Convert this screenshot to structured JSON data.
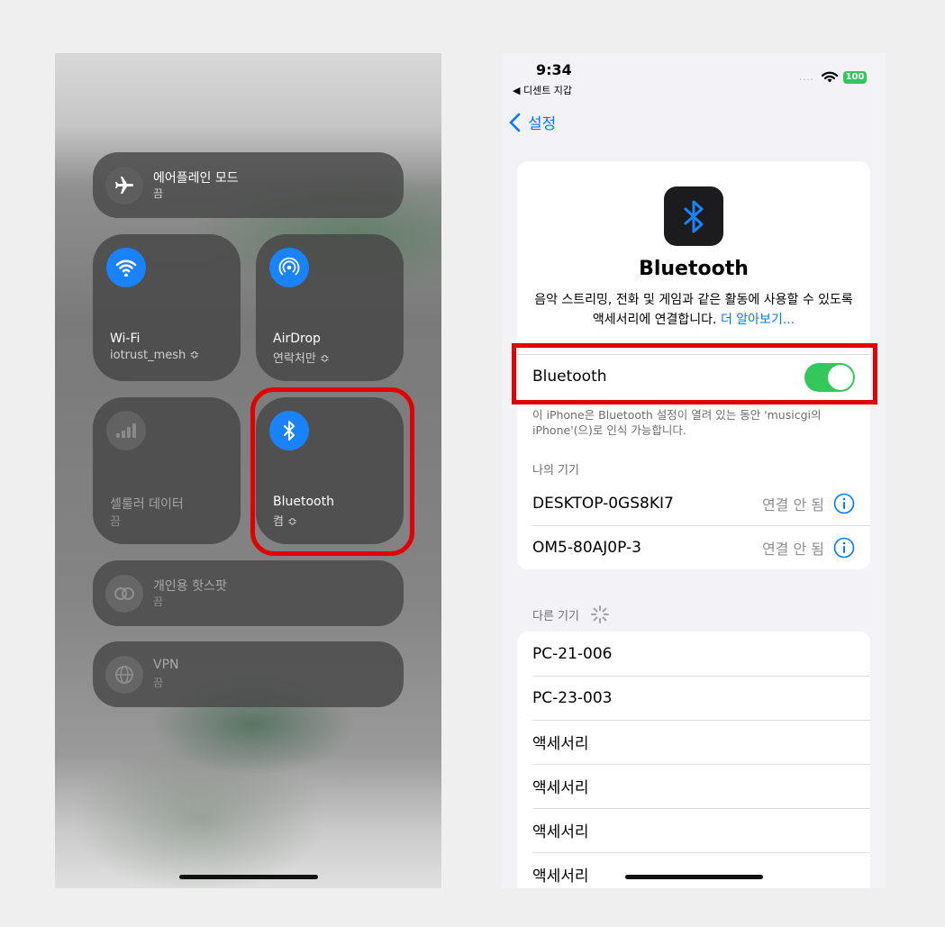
{
  "control_center": {
    "airplane": {
      "label": "에어플레인 모드",
      "status": "끔"
    },
    "wifi": {
      "label": "Wi-Fi",
      "network": "iotrust_mesh ≎"
    },
    "airdrop": {
      "label": "AirDrop",
      "status": "연락처만 ≎"
    },
    "cellular": {
      "label": "셀룰러 데이터",
      "status": "끔"
    },
    "bluetooth": {
      "label": "Bluetooth",
      "status": "켬 ≎"
    },
    "hotspot": {
      "label": "개인용 핫스팟",
      "status": "끔"
    },
    "vpn": {
      "label": "VPN",
      "status": "끔"
    }
  },
  "settings": {
    "status_bar": {
      "time": "9:34",
      "back_app": "◀ 디센트 지갑",
      "battery": "100",
      "signal": "...."
    },
    "nav": {
      "back_label": "설정"
    },
    "header": {
      "title": "Bluetooth",
      "description": "음악 스트리밍, 전화 및 게임과 같은 활동에 사용할 수 있도록 액세서리에 연결합니다.",
      "learn_more": "더 알아보기..."
    },
    "toggle": {
      "label": "Bluetooth",
      "state": "on"
    },
    "discoverable_note": "이 iPhone은 Bluetooth 설정이 열려 있는 동안 'musicgi의 iPhone'(으)로 인식 가능합니다.",
    "my_devices": {
      "header": "나의 기기",
      "items": [
        {
          "name": "DESKTOP-0GS8KI7",
          "status": "연결 안 됨"
        },
        {
          "name": "OM5-80AJ0P-3",
          "status": "연결 안 됨"
        }
      ]
    },
    "other_devices": {
      "header": "다른 기기",
      "items": [
        {
          "name": "PC-21-006"
        },
        {
          "name": "PC-23-003"
        },
        {
          "name": "액세서리"
        },
        {
          "name": "액세서리"
        },
        {
          "name": "액세서리"
        },
        {
          "name": "액세서리"
        }
      ]
    }
  },
  "colors": {
    "highlight": "#e00000",
    "ios_blue": "#007aff",
    "toggle_on": "#34c759"
  }
}
